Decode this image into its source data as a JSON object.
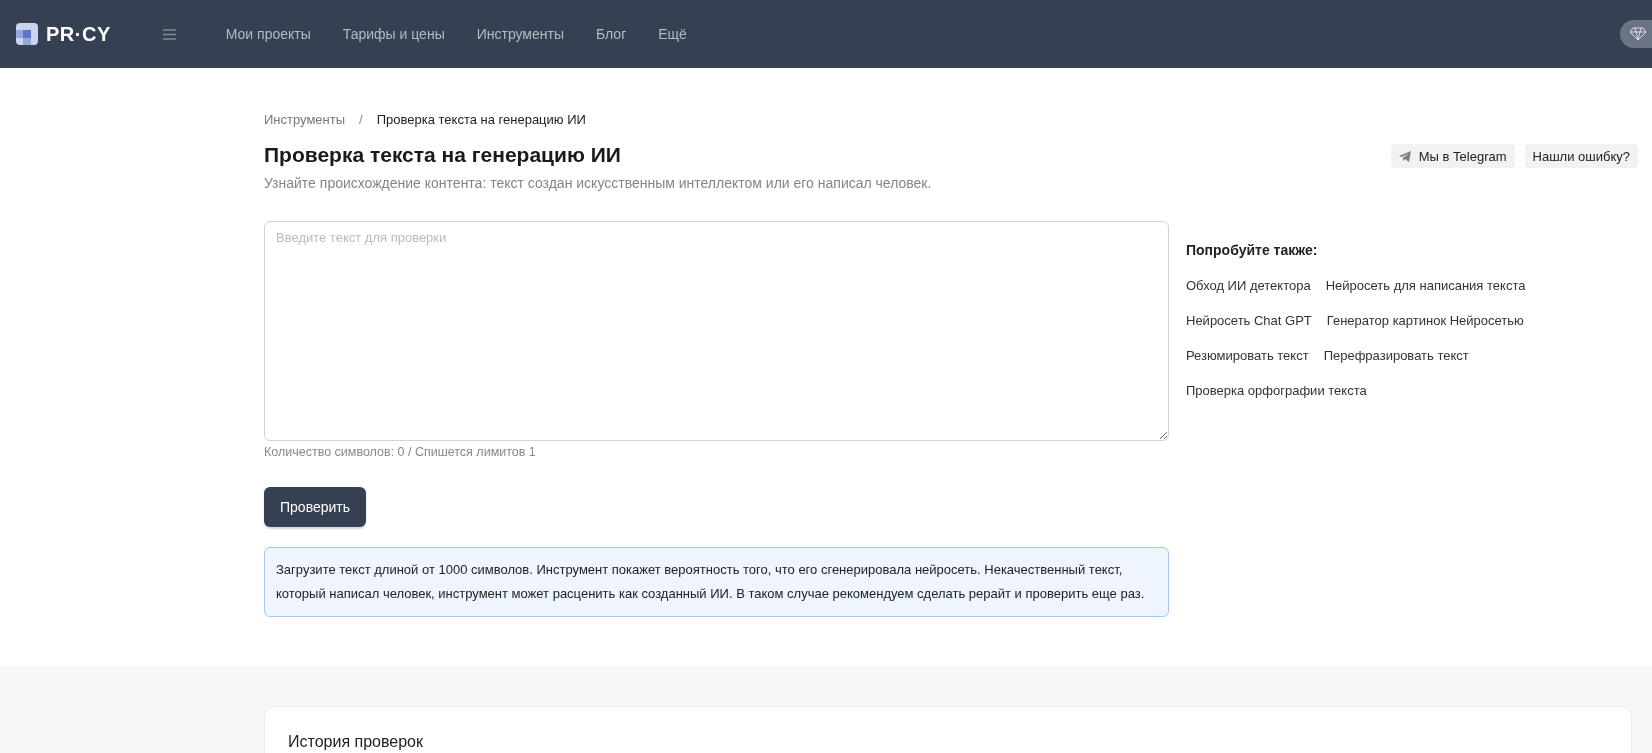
{
  "header": {
    "logo": "PR·CY",
    "nav": [
      {
        "label": "Мои проекты"
      },
      {
        "label": "Тарифы и цены"
      },
      {
        "label": "Инструменты"
      },
      {
        "label": "Блог"
      },
      {
        "label": "Ещё"
      }
    ]
  },
  "breadcrumbs": [
    {
      "label": "Инструменты",
      "current": false
    },
    {
      "label": "Проверка текста на генерацию ИИ",
      "current": true
    }
  ],
  "breadcrumb_separator": "/",
  "title": "Проверка текста на генерацию ИИ",
  "subtitle": "Узнайте происхождение контента: текст создан искусственным интеллектом или его написал человек.",
  "actions": [
    {
      "label": "Мы в Telegram",
      "kind": "telegram"
    },
    {
      "label": "Нашли ошибку?",
      "kind": "plain"
    }
  ],
  "text_field": {
    "placeholder": "Введите текст для проверки"
  },
  "counter": "Количество символов: 0 / Спишется лимитов 1",
  "submit": "Проверить",
  "info": "Загрузите текст длиной от 1000 символов. Инструмент покажет вероятность того, что его сгенерировала нейросеть. Некачественный текст, который написал человек, инструмент может расценить как созданный ИИ. В таком случае рекомендуем сделать рерайт и проверить еще раз.",
  "sidebar": {
    "title": "Попробуйте также:",
    "links": [
      [
        "Обход ИИ детектора",
        "Нейросеть для написания текста"
      ],
      [
        "Нейросеть Chat GPT",
        "Генератор картинок Нейросетью"
      ],
      [
        "Резюмировать текст",
        "Перефразировать текст"
      ],
      [
        "Проверка орфографии текста"
      ]
    ]
  },
  "history": {
    "title": "История проверок"
  }
}
